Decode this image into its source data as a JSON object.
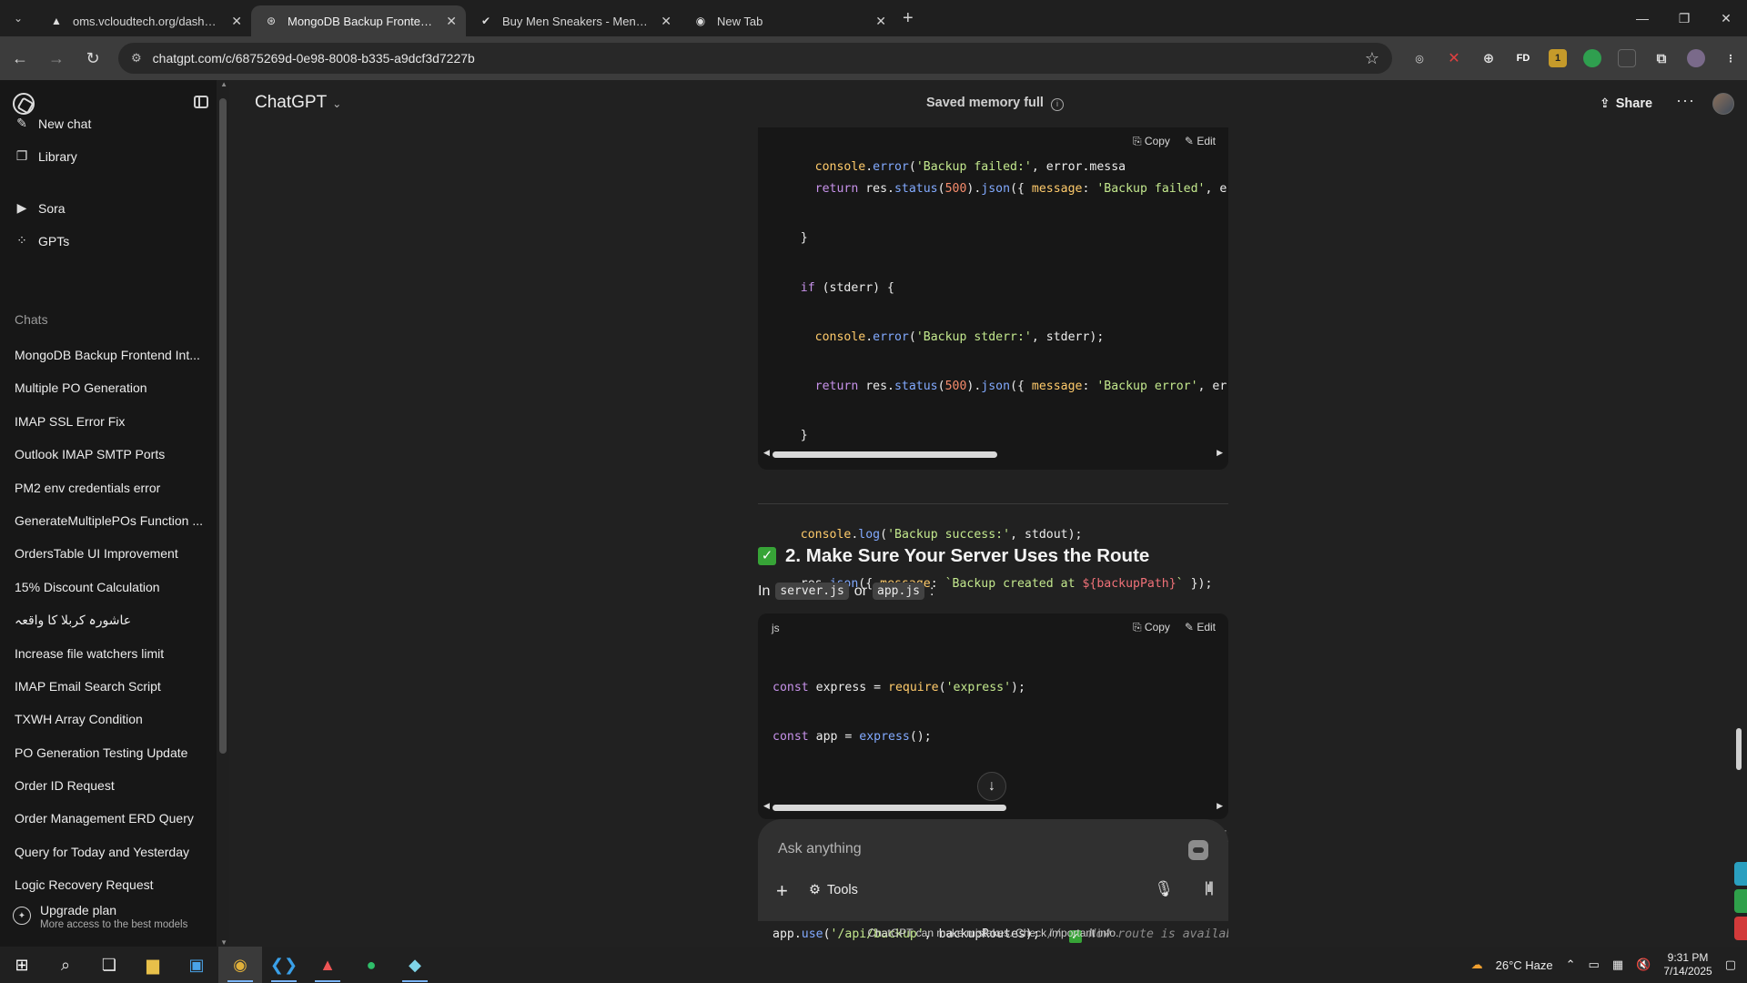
{
  "browser": {
    "tabs": [
      {
        "title": "oms.vcloudtech.org/dashboard",
        "icon": "triangle-icon",
        "active": false
      },
      {
        "title": "MongoDB Backup Frontend Int",
        "icon": "chatgpt-icon",
        "active": true
      },
      {
        "title": "Buy Men Sneakers - Men's Urb",
        "icon": "brand-icon",
        "active": false
      },
      {
        "title": "New Tab",
        "icon": "chrome-icon",
        "active": false
      }
    ],
    "url": "chatgpt.com/c/6875269d-0e98-8008-b335-a9dcf3d7227b"
  },
  "sidebar": {
    "nav": [
      {
        "label": "New chat",
        "icon": "edit-icon"
      },
      {
        "label": "Library",
        "icon": "library-icon"
      },
      {
        "label": "Sora",
        "icon": "play-icon"
      },
      {
        "label": "GPTs",
        "icon": "grid-icon"
      }
    ],
    "chats_label": "Chats",
    "chats": [
      "MongoDB Backup Frontend Int...",
      "Multiple PO Generation",
      "IMAP SSL Error Fix",
      "Outlook IMAP SMTP Ports",
      "PM2 env credentials error",
      "GenerateMultiplePOs Function ...",
      "OrdersTable UI Improvement",
      "15% Discount Calculation",
      "عاشورہ کربلا کا واقعہ",
      "Increase file watchers limit",
      "IMAP Email Search Script",
      "TXWH Array Condition",
      "PO Generation Testing Update",
      "Order ID Request",
      "Order Management ERD Query",
      "Query for Today and Yesterday",
      "Logic Recovery Request"
    ],
    "upgrade_title": "Upgrade plan",
    "upgrade_subtitle": "More access to the best models"
  },
  "header": {
    "model": "ChatGPT",
    "memory": "Saved memory full",
    "share": "Share"
  },
  "code_actions": {
    "copy": "Copy",
    "edit": "Edit"
  },
  "section": {
    "heading": "2. Make Sure Your Server Uses the Route",
    "intro_prefix": "In",
    "file1": "server.js",
    "intro_or": "or",
    "file2": "app.js",
    "intro_suffix": ":",
    "lang": "js"
  },
  "composer": {
    "placeholder": "Ask anything",
    "tools": "Tools"
  },
  "disclaimer": "ChatGPT can make mistakes. Check important info.",
  "taskbar": {
    "weather": "26°C  Haze",
    "time": "9:31 PM",
    "date": "7/14/2025"
  },
  "scroll": {
    "code1_thumb_fraction": 0.51,
    "code2_thumb_fraction": 0.53
  }
}
